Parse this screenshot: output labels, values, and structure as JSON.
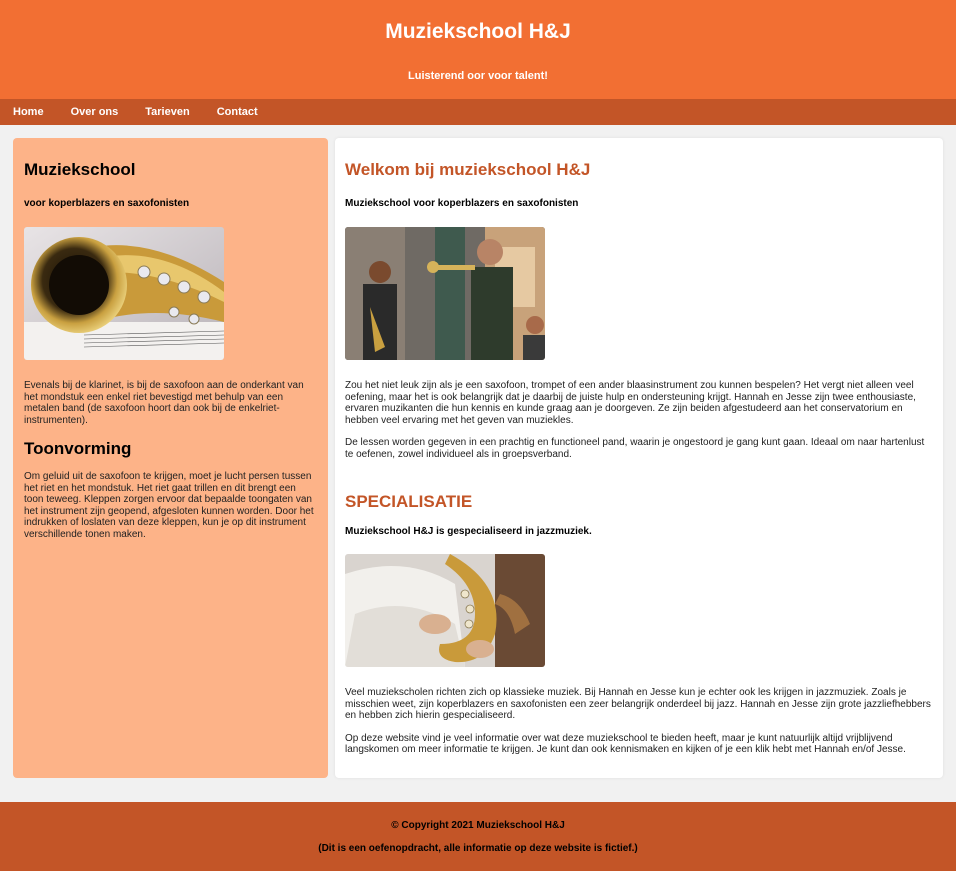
{
  "header": {
    "title": "Muziekschool H&J",
    "tagline": "Luisterend oor voor talent!"
  },
  "nav": {
    "items": [
      "Home",
      "Over ons",
      "Tarieven",
      "Contact"
    ]
  },
  "sidebar": {
    "heading": "Muziekschool",
    "subheading": "voor koperblazers en saxofonisten",
    "paragraph1": "Evenals bij de klarinet, is bij de saxofoon aan de onderkant van het mondstuk een enkel riet bevestigd met behulp van een metalen band (de saxofoon hoort dan ook bij de enkelriet-instrumenten).",
    "heading2": "Toonvorming",
    "paragraph2": "Om geluid uit de saxofoon te krijgen, moet je lucht persen tussen het riet en het mondstuk. Het riet gaat trillen en dit brengt een toon teweeg. Kleppen zorgen ervoor dat bepaalde toongaten van het instrument zijn geopend, afgesloten kunnen worden. Door het indrukken of loslaten van deze kleppen, kun je op dit instrument verschillende tonen maken."
  },
  "main": {
    "welcome_heading": "Welkom bij muziekschool H&J",
    "welcome_sub": "Muziekschool voor koperblazers en saxofonisten",
    "welcome_p1": "Zou het niet leuk zijn als je een saxofoon, trompet of een ander blaasinstrument zou kunnen bespelen? Het vergt niet alleen veel oefening, maar het is ook belangrijk dat je daarbij de juiste hulp en ondersteuning krijgt. Hannah en Jesse zijn twee enthousiaste, ervaren muzikanten die hun kennis en kunde graag aan je doorgeven. Ze zijn beiden afgestudeerd aan het conservatorium en hebben veel ervaring met het geven van muziekles.",
    "welcome_p2": "De lessen worden gegeven in een prachtig en functioneel pand, waarin je ongestoord je gang kunt gaan. Ideaal om naar hartenlust te oefenen, zowel individueel als in groepsverband.",
    "spec_heading": "SPECIALISATIE",
    "spec_sub": "Muziekschool H&J is gespecialiseerd in jazzmuziek.",
    "spec_p1": "Veel muziekscholen richten zich op klassieke muziek. Bij Hannah en Jesse kun je echter ook les krijgen in jazzmuziek. Zoals je misschien weet, zijn koperblazers en saxofonisten een zeer belangrijk onderdeel bij jazz. Hannah en Jesse zijn grote jazzliefhebbers en hebben zich hierin gespecialiseerd.",
    "spec_p2": "Op deze website vind je veel informatie over wat deze muziekschool te bieden heeft, maar je kunt natuurlijk altijd vrijblijvend langskomen om meer informatie te krijgen. Je kunt dan ook kennismaken en kijken of je een klik hebt met Hannah en/of Jesse."
  },
  "footer": {
    "copyright": "© Copyright 2021 Muziekschool H&J",
    "note": "(Dit is een oefenopdracht, alle informatie op deze website is fictief.)"
  },
  "colors": {
    "header": "#f26f33",
    "nav": "#c35527",
    "sidebar": "#fdb388",
    "accent": "#c35527"
  }
}
